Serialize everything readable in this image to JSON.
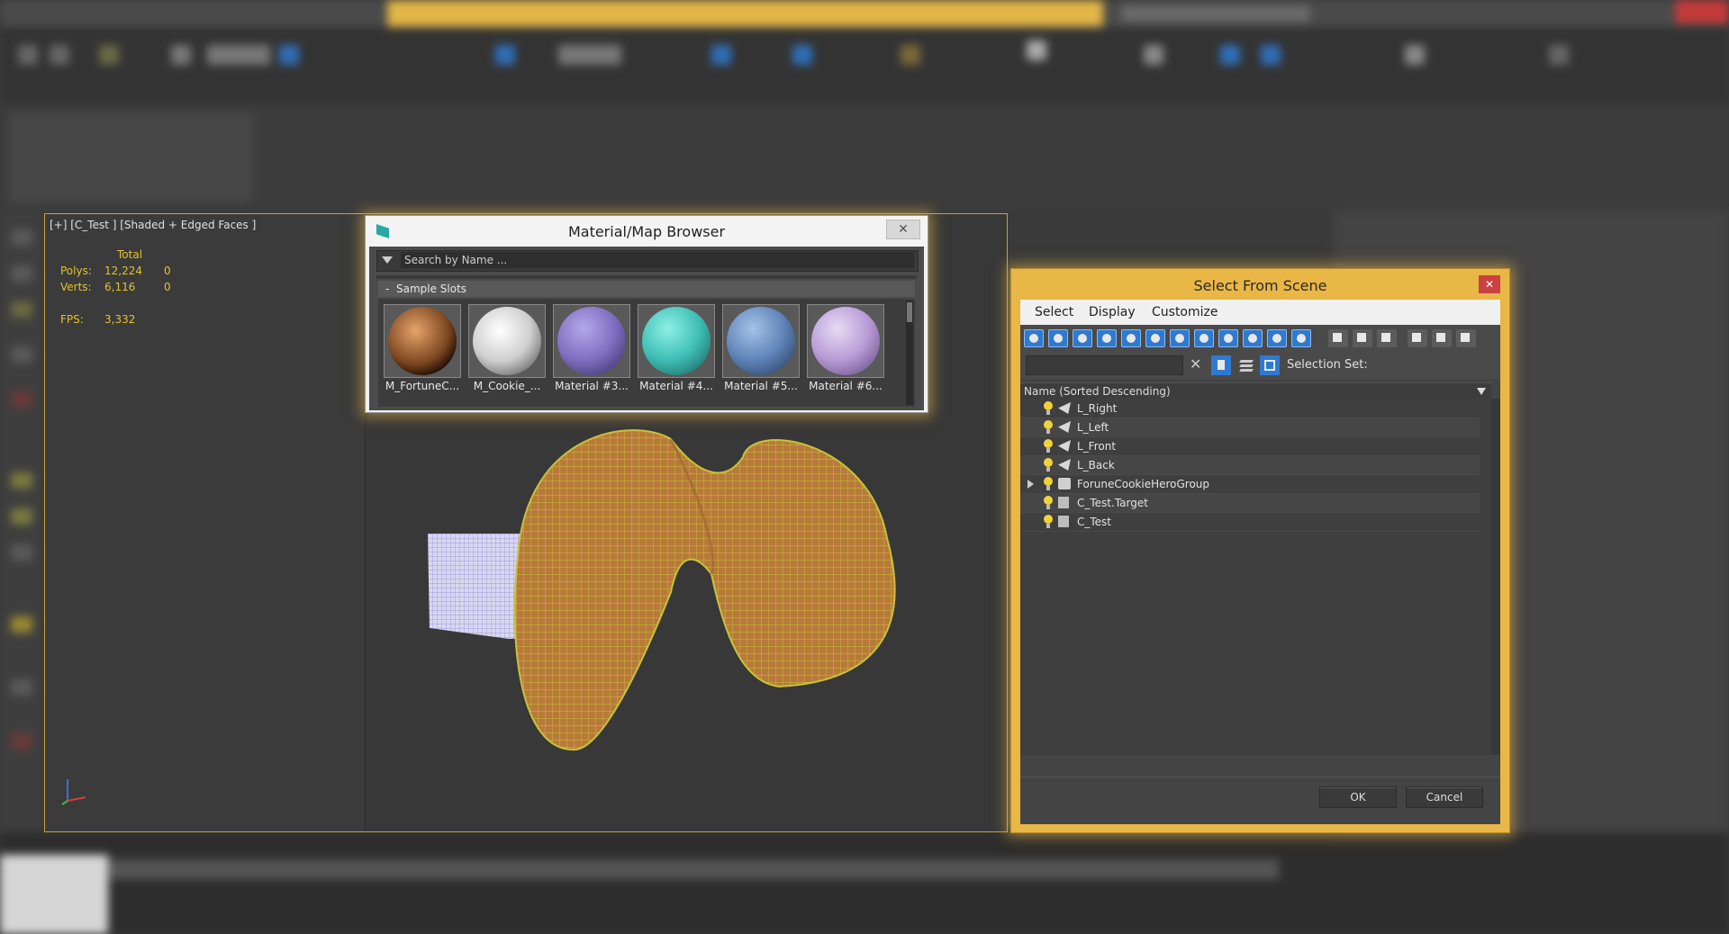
{
  "viewport": {
    "label": "[+] [C_Test ] [Shaded + Edged Faces ]",
    "stats": {
      "total_label": "Total",
      "polys_label": "Polys:",
      "polys_value": "12,224",
      "polys_sel": "0",
      "verts_label": "Verts:",
      "verts_value": "6,116",
      "verts_sel": "0",
      "fps_label": "FPS:",
      "fps_value": "3,332"
    }
  },
  "material_browser": {
    "title": "Material/Map Browser",
    "search_placeholder": "Search by Name ...",
    "section_label": "Sample Slots",
    "slots": [
      {
        "label": "M_FortuneC...",
        "color": "#8a5a32"
      },
      {
        "label": "M_Cookie_...",
        "color": "#d9d9d9"
      },
      {
        "label": "Material #3...",
        "color": "#7e6fc0"
      },
      {
        "label": "Material #4...",
        "color": "#3fbeb5"
      },
      {
        "label": "Material #5...",
        "color": "#5f84b8"
      },
      {
        "label": "Material #6...",
        "color": "#b79bd6"
      }
    ]
  },
  "select_scene": {
    "title": "Select From Scene",
    "menu": [
      "Select",
      "Display",
      "Customize"
    ],
    "selection_set_label": "Selection Set:",
    "column_header": "Name (Sorted Descending)",
    "items": [
      {
        "name": "L_Right",
        "icon": "light-icon",
        "expandable": false
      },
      {
        "name": "L_Left",
        "icon": "light-icon",
        "expandable": false
      },
      {
        "name": "L_Front",
        "icon": "light-icon",
        "expandable": false
      },
      {
        "name": "L_Back",
        "icon": "light-icon",
        "expandable": false
      },
      {
        "name": "ForuneCookieHeroGroup",
        "icon": "group-icon",
        "expandable": true
      },
      {
        "name": "C_Test.Target",
        "icon": "camera-target-icon",
        "expandable": false
      },
      {
        "name": "C_Test",
        "icon": "camera-icon",
        "expandable": false
      }
    ],
    "ok_label": "OK",
    "cancel_label": "Cancel"
  },
  "colors": {
    "accent_yellow": "#e9b746",
    "close_red": "#c94141",
    "tool_blue": "#2f7ad1",
    "mesh_wire": "#c9c23a"
  }
}
